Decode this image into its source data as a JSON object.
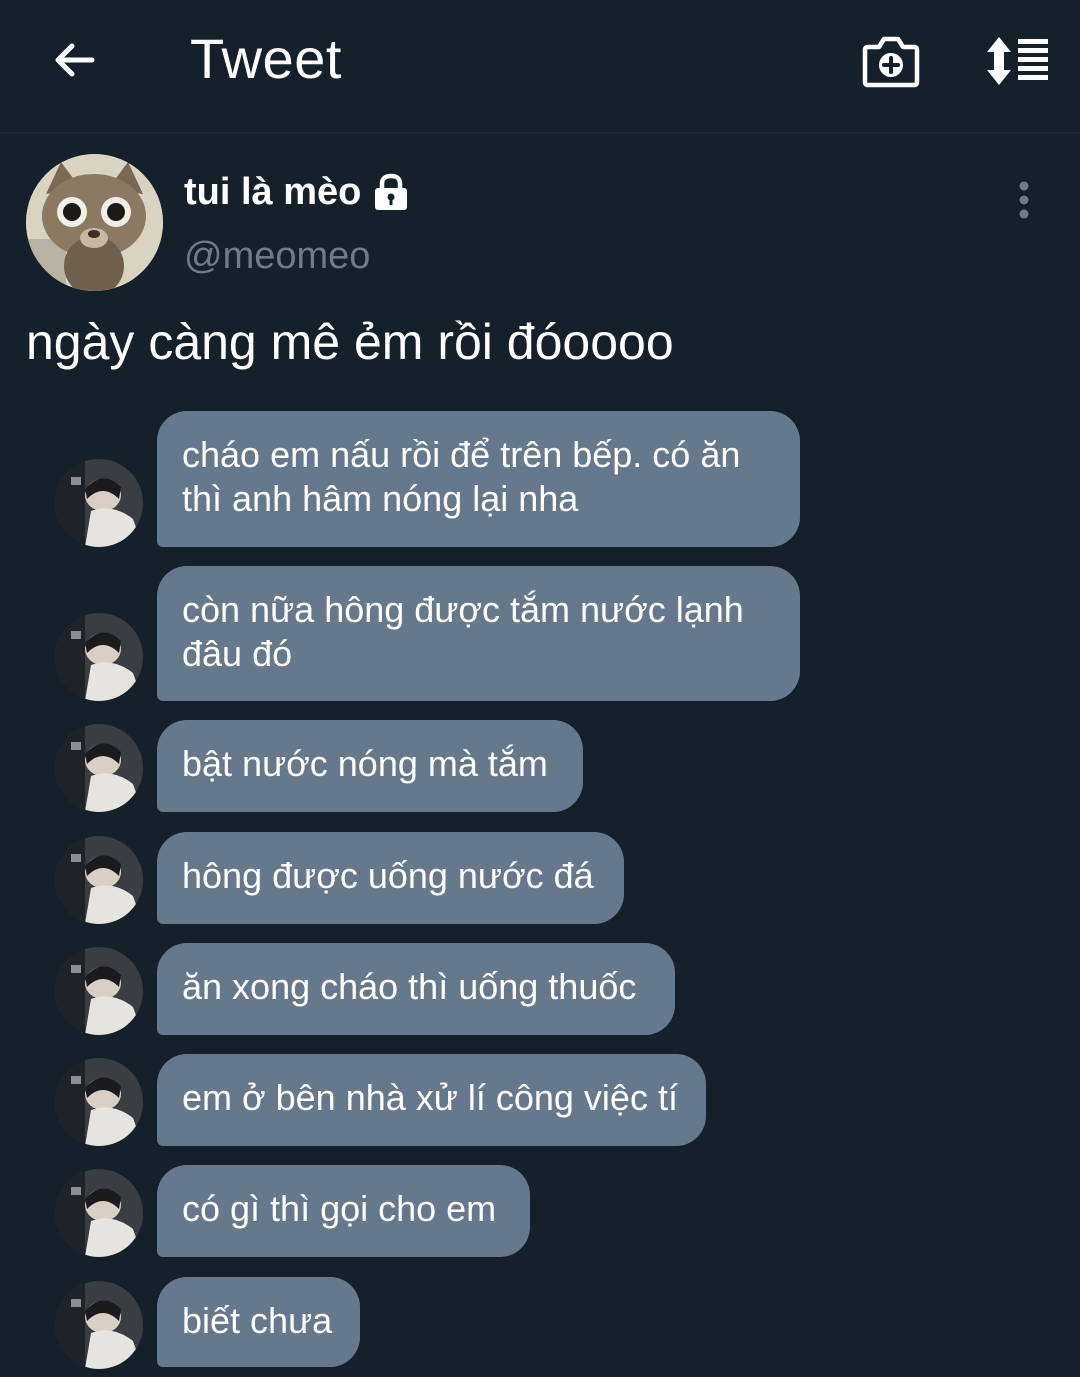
{
  "header": {
    "title": "Tweet",
    "back_icon": "arrow-left-icon",
    "camera_icon": "camera-add-icon",
    "sort_icon": "sort-list-icon"
  },
  "author": {
    "display_name": "tui là mèo",
    "handle": "@meomeo",
    "protected_icon": "lock-icon"
  },
  "tweet": {
    "text": "ngày càng mê ẻm rồi đóoooo"
  },
  "chat": {
    "messages": [
      {
        "line1": "cháo em nấu rồi để trên bếp. có ăn",
        "line2": "thì anh hâm nóng lại nha"
      },
      {
        "line1": "còn nữa hông được tắm nước lạnh",
        "line2": "đâu đó"
      },
      {
        "line1": "bật nước nóng mà tắm",
        "line2": ""
      },
      {
        "line1": "hông được uống nước đá",
        "line2": ""
      },
      {
        "line1": "ăn xong cháo thì uống thuốc",
        "line2": ""
      },
      {
        "line1": "em ở bên nhà xử lí công việc tí",
        "line2": ""
      },
      {
        "line1": "có gì thì gọi cho em",
        "line2": ""
      },
      {
        "line1": "biết chưa",
        "line2": ""
      }
    ]
  },
  "colors": {
    "background": "#15202b",
    "bubble": "#66788b",
    "handle": "#6e7b88"
  }
}
